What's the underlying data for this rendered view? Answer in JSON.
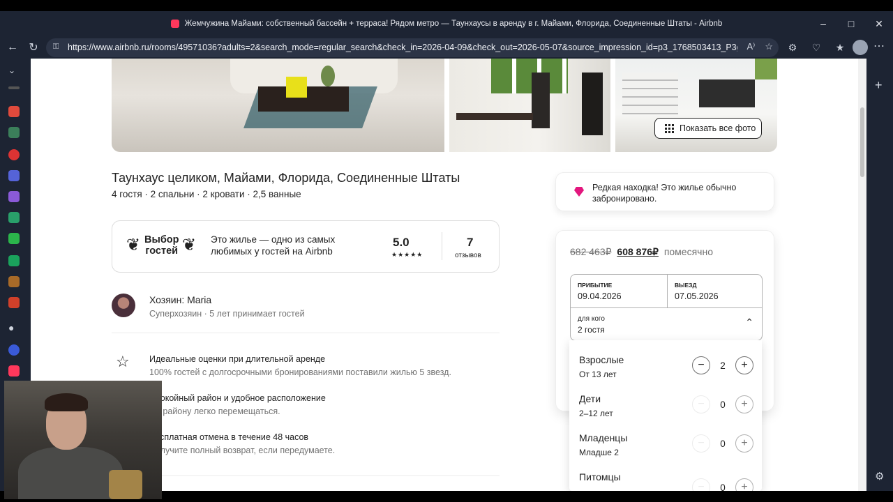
{
  "browser": {
    "window_title": "Жемчужина Майами: собственный бассейн + терраса! Рядом метро — Таунхаусы в аренду в г. Майами, Флорида, Соединенные Штаты - Airbnb",
    "url": "https://www.airbnb.ru/rooms/49571036?adults=2&search_mode=regular_search&check_in=2026-04-09&check_out=2026-05-07&source_impression_id=p3_1768503413_P3gNdV2i...",
    "accent": "#ff385c"
  },
  "photos": {
    "show_all_label": "Показать все фото"
  },
  "listing": {
    "title": "Таунхаус целиком, Майами, Флорида, Соединенные Штаты",
    "subtitle": "4 гостя · 2 спальни · 2 кровати · 2,5 ванные"
  },
  "guest_favorite": {
    "badge_line1": "Выбор",
    "badge_line2": "гостей",
    "text": "Это жилье — одно из самых любимых у гостей на Airbnb",
    "rating": "5.0",
    "stars": "★★★★★",
    "reviews_count": "7",
    "reviews_label": "отзывов"
  },
  "host": {
    "name": "Хозяин: Maria",
    "details": "Суперхозяин · 5 лет принимает гостей"
  },
  "features": [
    {
      "title": "Идеальные оценки при длительной аренде",
      "desc": "100% гостей с долгосрочными бронированиями поставили жилью 5 звезд."
    },
    {
      "title": "Спокойный район и удобное расположение",
      "desc": "По району легко перемещаться."
    },
    {
      "title": "Бесплатная отмена в течение 48 часов",
      "desc": "Получите полный возврат, если передумаете."
    }
  ],
  "rare_find": {
    "text": "Редкая находка! Это жилье обычно забронировано."
  },
  "booking": {
    "old_price": "682 463₽",
    "new_price": "608 876₽",
    "period": "помесячно",
    "checkin_label": "Прибытие",
    "checkin_value": "09.04.2026",
    "checkout_label": "Выезд",
    "checkout_value": "07.05.2026",
    "guests_label": "для кого",
    "guests_value": "2 гостя"
  },
  "guest_picker": [
    {
      "title": "Взрослые",
      "sub": "От 13 лет",
      "value": "2"
    },
    {
      "title": "Дети",
      "sub": "2–12 лет",
      "value": "0"
    },
    {
      "title": "Младенцы",
      "sub": "Младше 2",
      "value": "0"
    },
    {
      "title": "Питомцы",
      "sub": "",
      "value": "0"
    }
  ]
}
